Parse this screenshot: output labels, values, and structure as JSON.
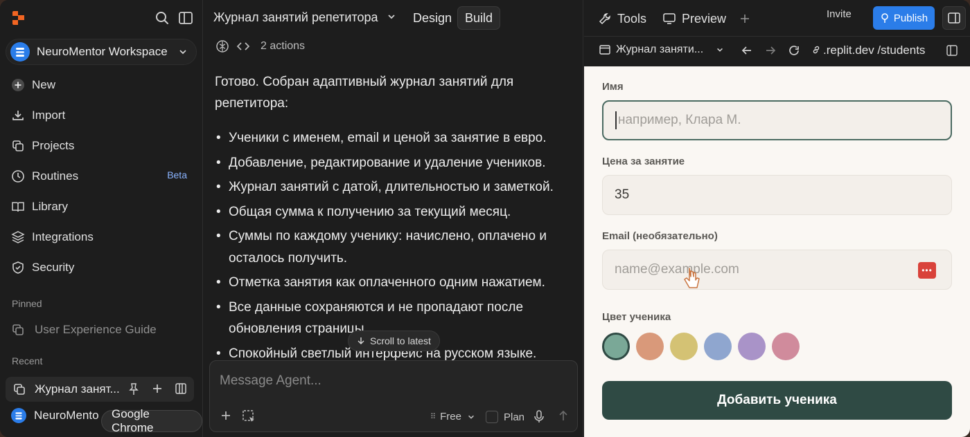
{
  "sidebar": {
    "workspace_name": "NeuroMentor Workspace",
    "nav": [
      {
        "label": "New",
        "icon": "plus-circle-icon"
      },
      {
        "label": "Import",
        "icon": "import-icon"
      },
      {
        "label": "Projects",
        "icon": "projects-icon"
      },
      {
        "label": "Routines",
        "icon": "clock-icon",
        "badge": "Beta"
      },
      {
        "label": "Library",
        "icon": "book-icon"
      },
      {
        "label": "Integrations",
        "icon": "layers-icon"
      },
      {
        "label": "Security",
        "icon": "shield-icon"
      }
    ],
    "pinned_label": "Pinned",
    "pinned_item": "User Experience Guide",
    "recent_label": "Recent",
    "recent_item": "Журнал занят...",
    "recent_item2": "NeuroMento",
    "tooltip": "Google Chrome"
  },
  "chat": {
    "title": "Журнал занятий репетитора",
    "mode_design": "Design",
    "mode_build": "Build",
    "actions": "2 actions",
    "intro": "Готово. Собран адаптивный журнал занятий для репетитора:",
    "items": [
      "Ученики с именем, email и ценой за занятие в евро.",
      "Добавление, редактирование и удаление учеников.",
      "Журнал занятий с датой, длительностью и заметкой.",
      "Общая сумма к получению за текущий месяц.",
      "Суммы по каждому ученику: начислено, оплачено и осталось получить.",
      "Отметка занятия как оплаченного одним нажатием.",
      "Все данные сохраняются и не пропадают после обновления страницы.",
      "Спокойный светлый интерфейс на русском языке."
    ],
    "scroll_latest": "Scroll to latest",
    "composer_placeholder": "Message Agent...",
    "free_label": "Free",
    "plan_label": "Plan"
  },
  "topbar": {
    "tools": "Tools",
    "preview": "Preview",
    "invite": "Invite",
    "publish": "Publish",
    "publish_color": "#2b7de9"
  },
  "urlbar": {
    "tab": "Журнал заняти...",
    "url": ".replit.dev /students"
  },
  "form": {
    "name_label": "Имя",
    "name_placeholder": "например, Клара М.",
    "price_label": "Цена за занятие",
    "price_value": "35",
    "email_label": "Email (необязательно)",
    "email_placeholder": "name@example.com",
    "color_label": "Цвет ученика",
    "colors": [
      "#7aa897",
      "#d9997a",
      "#d4c274",
      "#8fa6cf",
      "#a993c8",
      "#d08b9c"
    ],
    "selected_color": "#7aa897",
    "add_button": "Добавить ученика"
  }
}
